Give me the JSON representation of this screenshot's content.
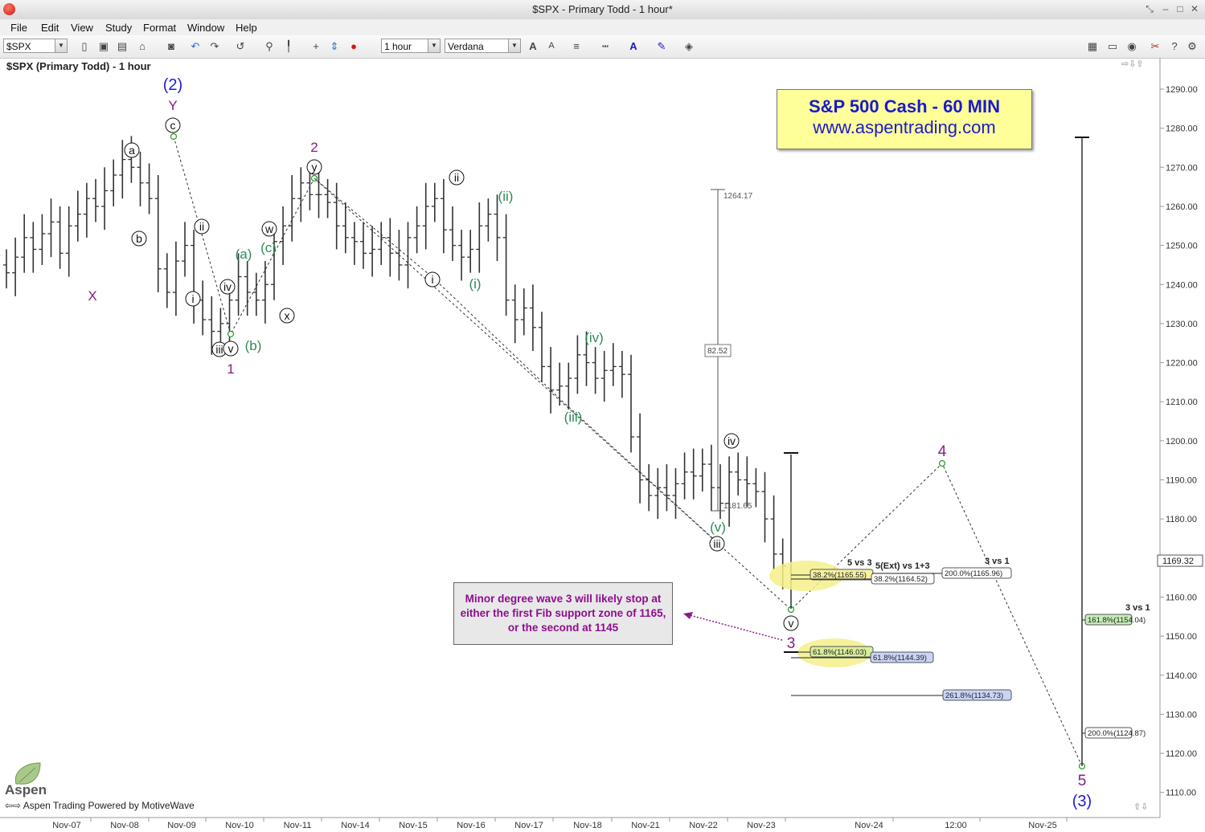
{
  "window": {
    "title": "$SPX - Primary Todd - 1 hour*"
  },
  "menu": [
    "File",
    "Edit",
    "View",
    "Study",
    "Format",
    "Window",
    "Help"
  ],
  "toolbar": {
    "symbol": "$SPX",
    "timeframe": "1 hour",
    "font": "Verdana"
  },
  "chart": {
    "title": "$SPX (Primary Todd) - 1 hour",
    "banner_line1": "S&P 500 Cash - 60 MIN",
    "banner_line2": "www.aspentrading.com",
    "note": "Minor degree wave 3 will likely stop at either the first Fib support zone of 1165, or the second at 1145",
    "footer": "Aspen Trading Powered by MotiveWave",
    "logo_text": "Aspen",
    "price_axis": [
      "1290.00",
      "1280.00",
      "1270.00",
      "1260.00",
      "1250.00",
      "1240.00",
      "1230.00",
      "1220.00",
      "1210.00",
      "1200.00",
      "1190.00",
      "1180.00",
      "1170.00",
      "1160.00",
      "1150.00",
      "1140.00",
      "1130.00",
      "1120.00",
      "1110.00"
    ],
    "current_price": "1169.32",
    "date_axis": [
      "Nov-07",
      "Nov-08",
      "Nov-09",
      "Nov-10",
      "Nov-11",
      "Nov-14",
      "Nov-15",
      "Nov-16",
      "Nov-17",
      "Nov-18",
      "Nov-21",
      "Nov-22",
      "Nov-23",
      "Nov-24",
      "12:00",
      "Nov-25"
    ],
    "measure": {
      "high": "1264.17",
      "low": "1181.65",
      "diff": "82.52"
    },
    "fib_labels": {
      "f1": "38.2%(1165.55)",
      "f2": "38.2%(1164.52)",
      "f3": "200.0%(1165.96)",
      "f4": "61.8%(1146.03)",
      "f5": "61.8%(1144.39)",
      "f6": "261.8%(1134.73)",
      "f7": "161.8%(1154.04)",
      "f8": "200.0%(1124.87)"
    },
    "fib_titles": {
      "t1": "5 vs 3",
      "t2": "5(Ext) vs 1+3",
      "t3": "3 vs 1",
      "t4": "3 vs 1"
    },
    "wave_labels": {
      "w2p": "(2)",
      "Y": "Y",
      "X": "X",
      "one": "1",
      "two": "2",
      "three": "3",
      "four": "4",
      "five": "5",
      "w3p": "(3)",
      "a": "a",
      "b": "b",
      "c": "c",
      "w": "w",
      "x": "x",
      "y": "y",
      "i_1": "i",
      "ii_1": "ii",
      "iii_1": "iii",
      "iv_1": "iv",
      "v_1": "v",
      "g_a": "(a)",
      "g_b": "(b)",
      "g_c": "(c)",
      "i_2": "i",
      "ii_2": "ii",
      "iii_2": "iii",
      "iv_2": "iv",
      "v_2": "v",
      "g_i": "(i)",
      "g_ii": "(ii)",
      "g_iii": "(iii)",
      "g_iv": "(iv)",
      "g_v": "(v)"
    },
    "colors": {
      "blue": "#1d1dd6",
      "purple": "#8b1a8b",
      "green": "#2e8b57",
      "bars": "#333333"
    }
  },
  "chart_data": {
    "type": "ohlc",
    "symbol": "$SPX",
    "interval": "1 hour",
    "y_range": [
      1105,
      1295
    ],
    "x_categories": [
      "Nov-07",
      "Nov-08",
      "Nov-09",
      "Nov-10",
      "Nov-11",
      "Nov-14",
      "Nov-15",
      "Nov-16",
      "Nov-17",
      "Nov-18",
      "Nov-21",
      "Nov-22",
      "Nov-23"
    ],
    "pivots": [
      {
        "date": "Nov-09",
        "price": 1277,
        "label": "c/Y/(2)"
      },
      {
        "date": "Nov-10",
        "price": 1226,
        "label": "1"
      },
      {
        "date": "Nov-11",
        "price": 1267,
        "label": "2"
      },
      {
        "date": "Nov-23",
        "price": 1157,
        "label": "3"
      },
      {
        "date": "Nov-24",
        "price": 1194,
        "label": "4"
      },
      {
        "date": "Nov-25",
        "price": 1117,
        "label": "5"
      }
    ],
    "closes": [
      1243,
      1247,
      1252,
      1249,
      1253,
      1256,
      1248,
      1255,
      1258,
      1262,
      1260,
      1264,
      1268,
      1272,
      1270,
      1266,
      1262,
      1244,
      1238,
      1246,
      1250,
      1236,
      1231,
      1228,
      1230,
      1236,
      1242,
      1238,
      1236,
      1240,
      1251,
      1255,
      1262,
      1266,
      1263,
      1263,
      1261,
      1255,
      1252,
      1251,
      1248,
      1249,
      1252,
      1248,
      1245,
      1252,
      1255,
      1260,
      1262,
      1254,
      1250,
      1247,
      1249,
      1255,
      1258,
      1252,
      1236,
      1231,
      1234,
      1229,
      1219,
      1213,
      1214,
      1216,
      1222,
      1220,
      1216,
      1218,
      1219,
      1217,
      1201,
      1190,
      1186,
      1188,
      1186,
      1189,
      1192,
      1191,
      1194,
      1188,
      1184,
      1192,
      1190,
      1189,
      1187,
      1180,
      1171,
      1168
    ]
  }
}
